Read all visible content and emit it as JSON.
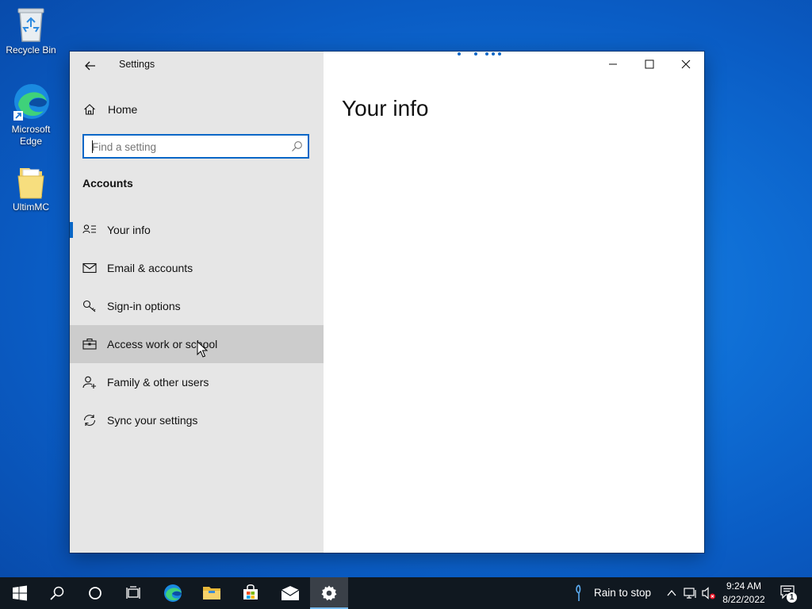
{
  "desktop": {
    "icons": [
      {
        "label": "Recycle Bin"
      },
      {
        "label": "Microsoft Edge"
      },
      {
        "label": "UltimMC"
      }
    ]
  },
  "window": {
    "app_title": "Settings",
    "home_label": "Home",
    "search": {
      "placeholder": "Find a setting",
      "value": ""
    },
    "section_title": "Accounts",
    "nav_items": [
      {
        "label": "Your info",
        "icon": "person-list-icon",
        "state": "selected"
      },
      {
        "label": "Email & accounts",
        "icon": "mail-icon",
        "state": ""
      },
      {
        "label": "Sign-in options",
        "icon": "key-icon",
        "state": ""
      },
      {
        "label": "Access work or school",
        "icon": "briefcase-icon",
        "state": "hover"
      },
      {
        "label": "Family & other users",
        "icon": "add-person-icon",
        "state": ""
      },
      {
        "label": "Sync your settings",
        "icon": "sync-icon",
        "state": ""
      }
    ],
    "page_title": "Your info",
    "accent_color": "#0a67c7"
  },
  "taskbar": {
    "weather_text": "Rain to stop",
    "time": "9:24 AM",
    "date": "8/22/2022",
    "notification_count": "1",
    "pinned": [
      "start-icon",
      "search-icon",
      "cortana-icon",
      "task-view-icon",
      "edge-icon",
      "file-explorer-icon",
      "store-icon",
      "mail-icon",
      "settings-icon"
    ]
  }
}
